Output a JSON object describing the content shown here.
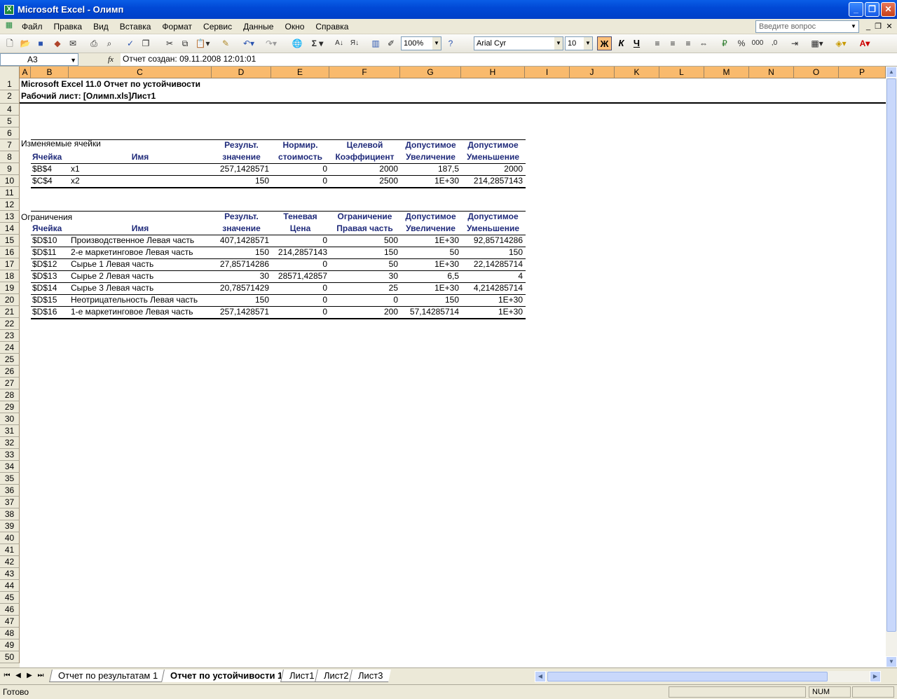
{
  "window": {
    "title": "Microsoft Excel - Олимп"
  },
  "menu": {
    "items": [
      "Файл",
      "Правка",
      "Вид",
      "Вставка",
      "Формат",
      "Сервис",
      "Данные",
      "Окно",
      "Справка"
    ],
    "help_placeholder": "Введите вопрос"
  },
  "toolbar": {
    "zoom": "100%",
    "font_name": "Arial Cyr",
    "font_size": "10",
    "bold": "Ж",
    "italic": "К",
    "underline": "Ч"
  },
  "formula_bar": {
    "name_box": "A3",
    "fx": "fx",
    "formula": "Отчет создан: 09.11.2008 12:01:01"
  },
  "columns": [
    "A",
    "B",
    "C",
    "D",
    "E",
    "F",
    "G",
    "H",
    "I",
    "J",
    "K",
    "L",
    "M",
    "N",
    "O",
    "P"
  ],
  "rows": [
    "1",
    "2",
    "4",
    "5",
    "6",
    "7",
    "8",
    "9",
    "10",
    "11",
    "12",
    "13",
    "14",
    "15",
    "16",
    "17",
    "18",
    "19",
    "20",
    "21",
    "22",
    "23",
    "24",
    "25",
    "26",
    "27",
    "28",
    "29",
    "30",
    "31",
    "32",
    "33",
    "34",
    "35",
    "36",
    "37",
    "38",
    "39",
    "40",
    "41",
    "42",
    "43",
    "44",
    "45",
    "46",
    "47",
    "48",
    "49",
    "50"
  ],
  "report": {
    "title": "Microsoft Excel 11.0 Отчет по устойчивости",
    "sheet": "Рабочий лист: [Олимп.xls]Лист1",
    "changing_cells": {
      "section": "Изменяемые ячейки",
      "hdr1": [
        "Результ.",
        "Нормир.",
        "Целевой",
        "Допустимое",
        "Допустимое"
      ],
      "hdr2": [
        "Ячейка",
        "Имя",
        "значение",
        "стоимость",
        "Коэффициент",
        "Увеличение",
        "Уменьшение"
      ],
      "rows": [
        [
          "$B$4",
          "x1",
          "257,1428571",
          "0",
          "2000",
          "187,5",
          "2000"
        ],
        [
          "$C$4",
          "x2",
          "150",
          "0",
          "2500",
          "1E+30",
          "214,2857143"
        ]
      ]
    },
    "constraints": {
      "section": "Ограничения",
      "hdr1": [
        "Результ.",
        "Теневая",
        "Ограничение",
        "Допустимое",
        "Допустимое"
      ],
      "hdr2": [
        "Ячейка",
        "Имя",
        "значение",
        "Цена",
        "Правая часть",
        "Увеличение",
        "Уменьшение"
      ],
      "rows": [
        [
          "$D$10",
          "Производственное Левая часть",
          "407,1428571",
          "0",
          "500",
          "1E+30",
          "92,85714286"
        ],
        [
          "$D$11",
          "2-е маркетинговое Левая часть",
          "150",
          "214,2857143",
          "150",
          "50",
          "150"
        ],
        [
          "$D$12",
          "Сырье 1 Левая часть",
          "27,85714286",
          "0",
          "50",
          "1E+30",
          "22,14285714"
        ],
        [
          "$D$13",
          "Сырье 2 Левая часть",
          "30",
          "28571,42857",
          "30",
          "6,5",
          "4"
        ],
        [
          "$D$14",
          "Сырье 3 Левая часть",
          "20,78571429",
          "0",
          "25",
          "1E+30",
          "4,214285714"
        ],
        [
          "$D$15",
          "Неотрицательность Левая часть",
          "150",
          "0",
          "0",
          "150",
          "1E+30"
        ],
        [
          "$D$16",
          "1-е маркетинговое Левая часть",
          "257,1428571",
          "0",
          "200",
          "57,14285714",
          "1E+30"
        ]
      ]
    }
  },
  "sheet_tabs": [
    "Отчет по результатам 1",
    "Отчет по устойчивости 1",
    "Лист1",
    "Лист2",
    "Лист3"
  ],
  "status": {
    "text": "Готово",
    "num": "NUM"
  }
}
